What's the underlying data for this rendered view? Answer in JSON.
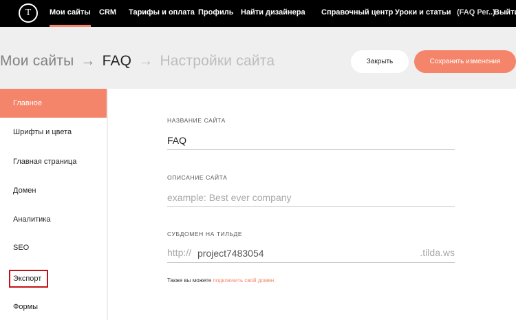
{
  "topbar": {
    "logo": "T",
    "nav": [
      {
        "label": "Мои сайты",
        "active": true
      },
      {
        "label": "CRM"
      },
      {
        "label": "Тарифы и оплата"
      },
      {
        "label": "Профиль"
      },
      {
        "label": "Найти дизайнера"
      }
    ],
    "right": [
      {
        "label": "Справочный центр"
      },
      {
        "label": "Уроки и статьи"
      },
      {
        "label": "(FAQ Рег..)"
      },
      {
        "label": "Выйти"
      }
    ]
  },
  "breadcrumb": {
    "root": "Мои сайты",
    "separator": "→",
    "site": "FAQ",
    "current": "Настройки сайта"
  },
  "actions": {
    "close_label": "Закрыть",
    "save_label": "Сохранить изменения"
  },
  "sidebar": {
    "items": [
      {
        "label": "Главное",
        "active": true
      },
      {
        "label": "Шрифты и цвета"
      },
      {
        "label": "Главная страница"
      },
      {
        "label": "Домен"
      },
      {
        "label": "Аналитика"
      },
      {
        "label": "SEO"
      },
      {
        "label": "Экспорт",
        "highlighted": true
      },
      {
        "label": "Формы"
      }
    ]
  },
  "form": {
    "site_name": {
      "label": "НАЗВАНИЕ САЙТА",
      "value": "FAQ"
    },
    "site_description": {
      "label": "ОПИСАНИЕ САЙТА",
      "value": "",
      "placeholder": "example: Best ever company"
    },
    "subdomain": {
      "label": "СУБДОМЕН НА ТИЛЬДЕ",
      "prefix": "http://",
      "value": "project7483054",
      "suffix": ".tilda.ws"
    },
    "hint_text": "Также вы можете",
    "hint_link": "подключить свой домен."
  },
  "colors": {
    "accent": "#f4846a",
    "topbar_bg": "#000000",
    "header_bg": "#efefef",
    "highlight_border": "#c4121a"
  }
}
